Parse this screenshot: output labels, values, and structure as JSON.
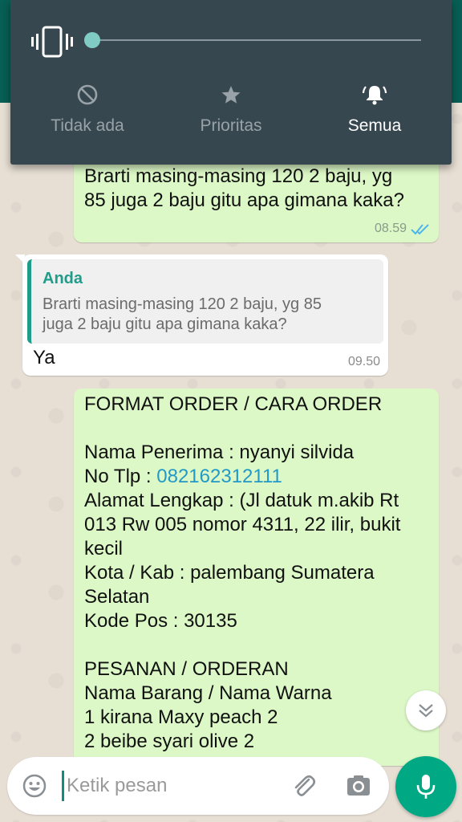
{
  "volume_panel": {
    "level": 0,
    "modes": [
      {
        "label": "Tidak ada",
        "icon": "block-icon",
        "active": false
      },
      {
        "label": "Prioritas",
        "icon": "star-icon",
        "active": false
      },
      {
        "label": "Semua",
        "icon": "bell-icon",
        "active": true
      }
    ]
  },
  "messages": [
    {
      "direction": "out",
      "lines": [
        "Brarti masing-masing 120 2 baju, yg",
        "85 juga 2 baju gitu apa gimana kaka?"
      ],
      "time": "08.59",
      "status": "read"
    },
    {
      "direction": "in",
      "quote_author": "Anda",
      "quote_lines": [
        "Brarti masing-masing 120 2 baju, yg 85",
        "juga 2 baju gitu apa gimana kaka?"
      ],
      "text": "Ya",
      "time": "09.50"
    },
    {
      "direction": "out",
      "lines": [
        "FORMAT ORDER / CARA ORDER",
        "",
        "Nama Penerima : nyanyi silvida",
        "No Tlp : ",
        "Alamat Lengkap : (Jl datuk m.akib Rt",
        "013 Rw 005 nomor 4311, 22 ilir, bukit",
        "kecil",
        "Kota / Kab  : palembang Sumatera",
        "Selatan",
        "Kode Pos : 30135",
        "",
        "PESANAN / ORDERAN",
        "Nama Barang / Nama Warna",
        "1 kirana Maxy peach 2",
        "2 beibe syari olive 2"
      ],
      "phone": "082162312111"
    }
  ],
  "composer": {
    "placeholder": "Ketik pesan"
  },
  "colors": {
    "outgoing_bubble": "#dcf8c6",
    "incoming_bubble": "#ffffff",
    "accent": "#00a884",
    "quote_accent": "#1f9d8a",
    "read_ticks": "#4fb6ec",
    "phone_link": "#2399c9"
  }
}
